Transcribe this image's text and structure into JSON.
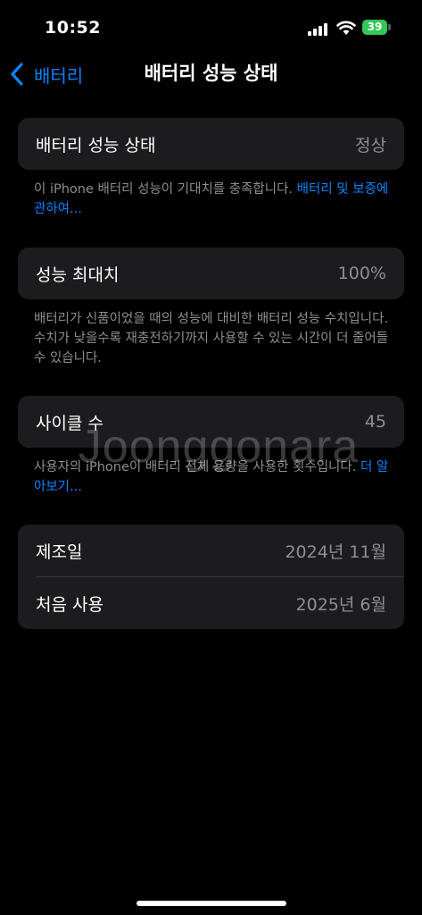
{
  "status_bar": {
    "time": "10:52",
    "battery": "39"
  },
  "nav": {
    "back_label": "배터리",
    "title": "배터리 성능 상태"
  },
  "health": {
    "label": "배터리 성능 상태",
    "value": "정상",
    "note": "이 iPhone 배터리 성능이 기대치를 충족합니다. ",
    "link": "배터리 및 보증에 관하여..."
  },
  "capacity": {
    "label": "성능 최대치",
    "value": "100%",
    "note": "배터리가 신품이었을 때의 성능에 대비한 배터리 성능 수치입니다. 수치가 낮을수록 재충전하기까지 사용할 수 있는 시간이 더 줄어들 수 있습니다."
  },
  "cycle": {
    "label": "사이클 수",
    "value": "45",
    "note": "사용자의 iPhone이 배터리 전체 용량을 사용한 횟수입니다. ",
    "link": "더 알아보기..."
  },
  "dates": [
    {
      "label": "제조일",
      "value": "2024년 11월"
    },
    {
      "label": "처음 사용",
      "value": "2025년 6월"
    }
  ],
  "watermark": "Joonggonara",
  "colors": {
    "accent": "#0a84ff",
    "battery": "#34c759",
    "card": "#1c1c1e"
  }
}
